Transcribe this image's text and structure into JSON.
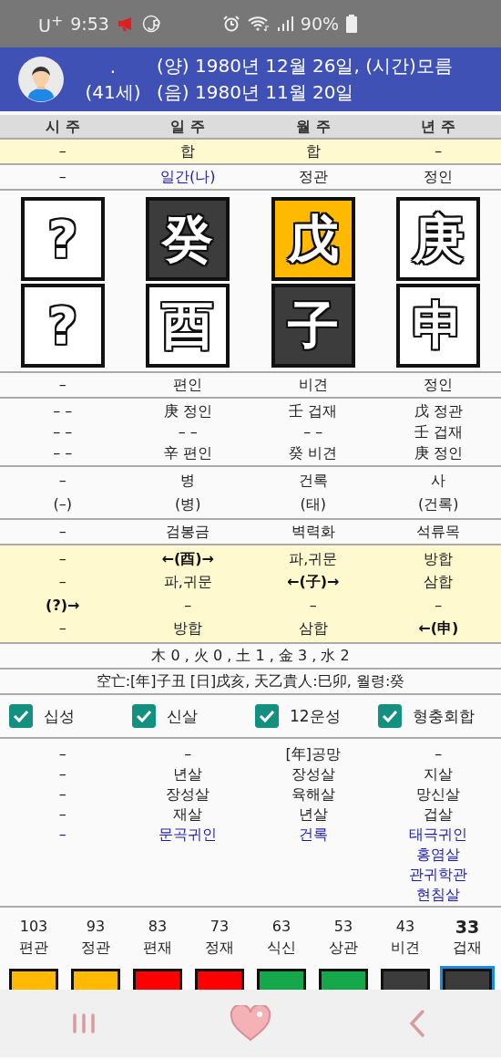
{
  "status_bar": {
    "carrier": "U$^{+}$",
    "time": "9:53",
    "battery": "90%"
  },
  "header": {
    "name": ".",
    "age": "(41세)",
    "solar": "(양) 1980년 12월 26일, (시간)모름",
    "lunar": "(음) 1980년 11월 20일"
  },
  "columns": [
    "시 주",
    "일 주",
    "월 주",
    "년 주"
  ],
  "upper_sections": [
    {
      "kind": "yellow",
      "rows": [
        [
          {
            "text": "–",
            "kind": "normal"
          },
          {
            "text": "합",
            "kind": "normal"
          },
          {
            "text": "합",
            "kind": "normal"
          },
          {
            "text": "–",
            "kind": "normal"
          }
        ]
      ]
    },
    {
      "kind": "plain",
      "rows": [
        [
          {
            "text": "–",
            "kind": "normal"
          },
          {
            "text": "일간(나)",
            "kind": "accent"
          },
          {
            "text": "정관",
            "kind": "normal"
          },
          {
            "text": "정인",
            "kind": "normal"
          }
        ]
      ]
    }
  ],
  "pillars": {
    "stems": [
      {
        "char": "?",
        "color": "#ffffff"
      },
      {
        "char": "癸",
        "color": "#3c3c3c"
      },
      {
        "char": "戊",
        "color": "#ffb900"
      },
      {
        "char": "庚",
        "color": "#ffffff"
      }
    ],
    "branches": [
      {
        "char": "?",
        "color": "#ffffff"
      },
      {
        "char": "酉",
        "color": "#ffffff"
      },
      {
        "char": "子",
        "color": "#3c3c3c"
      },
      {
        "char": "申",
        "color": "#ffffff"
      }
    ]
  },
  "lower_sections": [
    {
      "kind": "plain",
      "rows": [
        [
          {
            "text": "–",
            "kind": "normal"
          },
          {
            "text": "편인",
            "kind": "normal"
          },
          {
            "text": "비견",
            "kind": "normal"
          },
          {
            "text": "정인",
            "kind": "normal"
          }
        ]
      ]
    },
    {
      "kind": "plain",
      "rows": [
        [
          {
            "text": "– –",
            "kind": "normal"
          },
          {
            "text": "庚 정인",
            "kind": "normal"
          },
          {
            "text": "壬 겁재",
            "kind": "normal"
          },
          {
            "text": "戊 정관",
            "kind": "normal"
          }
        ],
        [
          {
            "text": "– –",
            "kind": "normal"
          },
          {
            "text": "– –",
            "kind": "normal"
          },
          {
            "text": "– –",
            "kind": "normal"
          },
          {
            "text": "壬 겁재",
            "kind": "normal"
          }
        ],
        [
          {
            "text": "– –",
            "kind": "normal"
          },
          {
            "text": "辛 편인",
            "kind": "normal"
          },
          {
            "text": "癸 비견",
            "kind": "normal"
          },
          {
            "text": "庚 정인",
            "kind": "normal"
          }
        ]
      ]
    },
    {
      "kind": "plain",
      "rows": [
        [
          {
            "text": "–",
            "kind": "normal"
          },
          {
            "text": "병",
            "kind": "normal"
          },
          {
            "text": "건록",
            "kind": "normal"
          },
          {
            "text": "사",
            "kind": "normal"
          }
        ],
        [
          {
            "text": "(–)",
            "kind": "normal"
          },
          {
            "text": "(병)",
            "kind": "normal"
          },
          {
            "text": "(태)",
            "kind": "normal"
          },
          {
            "text": "(건록)",
            "kind": "normal"
          }
        ]
      ]
    },
    {
      "kind": "plain",
      "rows": [
        [
          {
            "text": "–",
            "kind": "normal"
          },
          {
            "text": "검봉금",
            "kind": "normal"
          },
          {
            "text": "벽력화",
            "kind": "normal"
          },
          {
            "text": "석류목",
            "kind": "normal"
          }
        ]
      ]
    },
    {
      "kind": "yellow",
      "rows": [
        [
          {
            "text": "–",
            "kind": "normal"
          },
          {
            "text": "←(酉)→",
            "kind": "bold"
          },
          {
            "text": "파,귀문",
            "kind": "normal"
          },
          {
            "text": "방합",
            "kind": "normal"
          }
        ],
        [
          {
            "text": "–",
            "kind": "normal"
          },
          {
            "text": "파,귀문",
            "kind": "normal"
          },
          {
            "text": "←(子)→",
            "kind": "bold"
          },
          {
            "text": "삼합",
            "kind": "normal"
          }
        ],
        [
          {
            "text": "(?)→",
            "kind": "bold"
          },
          {
            "text": "–",
            "kind": "normal"
          },
          {
            "text": "–",
            "kind": "normal"
          },
          {
            "text": "–",
            "kind": "normal"
          }
        ],
        [
          {
            "text": "–",
            "kind": "normal"
          },
          {
            "text": "방합",
            "kind": "normal"
          },
          {
            "text": "삼합",
            "kind": "normal"
          },
          {
            "text": "←(申)",
            "kind": "bold"
          }
        ]
      ]
    }
  ],
  "summary_lines": [
    "木 0 , 火 0 , 土 1 , 金 3 , 水 2",
    "空亡:[年]子丑 [日]戌亥, 天乙貴人:巳卯, 월령:癸"
  ],
  "toggles": [
    {
      "label": "십성",
      "checked": true
    },
    {
      "label": "신살",
      "checked": true
    },
    {
      "label": "12운성",
      "checked": true
    },
    {
      "label": "형충회합",
      "checked": true
    }
  ],
  "shinsal": [
    [
      {
        "text": "–",
        "kind": "normal"
      },
      {
        "text": "–",
        "kind": "normal"
      },
      {
        "text": "[年]공망",
        "kind": "normal"
      },
      {
        "text": "–",
        "kind": "normal"
      }
    ],
    [
      {
        "text": "–",
        "kind": "normal"
      },
      {
        "text": "년살",
        "kind": "normal"
      },
      {
        "text": "장성살",
        "kind": "normal"
      },
      {
        "text": "지살",
        "kind": "normal"
      }
    ],
    [
      {
        "text": "–",
        "kind": "normal"
      },
      {
        "text": "장성살",
        "kind": "normal"
      },
      {
        "text": "육해살",
        "kind": "normal"
      },
      {
        "text": "망신살",
        "kind": "normal"
      }
    ],
    [
      {
        "text": "–",
        "kind": "normal"
      },
      {
        "text": "재살",
        "kind": "normal"
      },
      {
        "text": "년살",
        "kind": "normal"
      },
      {
        "text": "겁살",
        "kind": "normal"
      }
    ],
    [
      {
        "text": "–",
        "kind": "accent"
      },
      {
        "text": "문곡귀인",
        "kind": "accent"
      },
      {
        "text": "건록",
        "kind": "accent"
      },
      {
        "text": "태극귀인\n홍염살\n관귀학관\n현침살",
        "kind": "accent"
      }
    ]
  ],
  "luck": [
    {
      "age": "103",
      "label": "편관",
      "color": "#ffb900",
      "selected": false
    },
    {
      "age": "93",
      "label": "정관",
      "color": "#ffb900",
      "selected": false
    },
    {
      "age": "83",
      "label": "편재",
      "color": "#ff0000",
      "selected": false
    },
    {
      "age": "73",
      "label": "정재",
      "color": "#ff0000",
      "selected": false
    },
    {
      "age": "63",
      "label": "식신",
      "color": "#14a84a",
      "selected": false
    },
    {
      "age": "53",
      "label": "상관",
      "color": "#14a84a",
      "selected": false
    },
    {
      "age": "43",
      "label": "비견",
      "color": "#3c3c3c",
      "selected": false
    },
    {
      "age": "33",
      "label": "겁재",
      "color": "#3c3c3c",
      "selected": true
    }
  ]
}
